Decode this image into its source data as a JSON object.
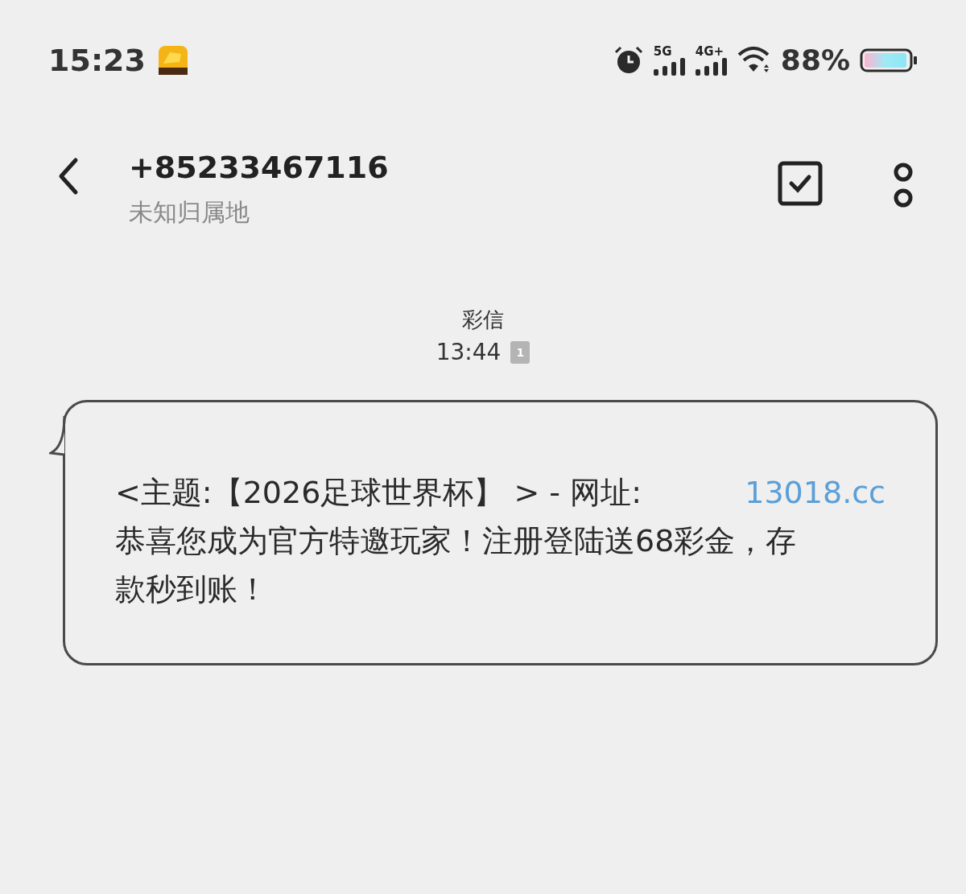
{
  "status_bar": {
    "time": "15:23",
    "network_5g": "5G",
    "network_4g": "4G+",
    "battery": "88%"
  },
  "header": {
    "title": "+85233467116",
    "subtitle": "未知归属地"
  },
  "message_meta": {
    "type_label": "彩信",
    "time": "13:44",
    "sim": "1"
  },
  "message": {
    "prefix": "<主题:【2026足球世界杯】 > - 网址:",
    "link": "13018.cc",
    "body": "恭喜您成为官方特邀玩家！注册登陆送68彩金，存款秒到账！"
  }
}
